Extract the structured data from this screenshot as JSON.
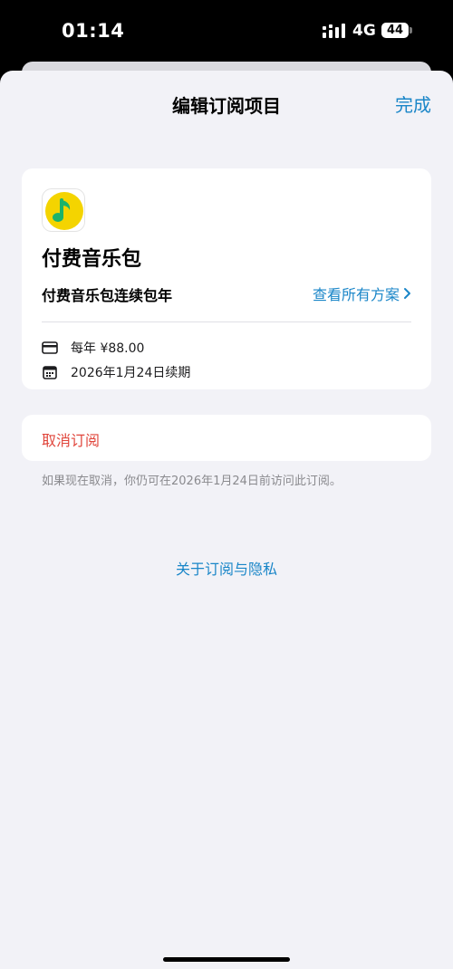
{
  "status_bar": {
    "time": "01:14",
    "network": "4G",
    "battery": "44"
  },
  "nav": {
    "title": "编辑订阅项目",
    "done_label": "完成"
  },
  "subscription": {
    "app_name": "付费音乐包",
    "plan_name": "付费音乐包连续包年",
    "view_plans_label": "查看所有方案",
    "price": "每年 ¥88.00",
    "renewal": "2026年1月24日续期"
  },
  "cancel": {
    "label": "取消订阅",
    "footnote": "如果现在取消，你仍可在2026年1月24日前访问此订阅。"
  },
  "privacy_link": "关于订阅与隐私",
  "colors": {
    "accent": "#1a86c8",
    "destructive": "#e0453b",
    "background": "#f2f2f7",
    "app_icon_yellow": "#f4d400",
    "app_icon_green": "#1bb36b"
  }
}
